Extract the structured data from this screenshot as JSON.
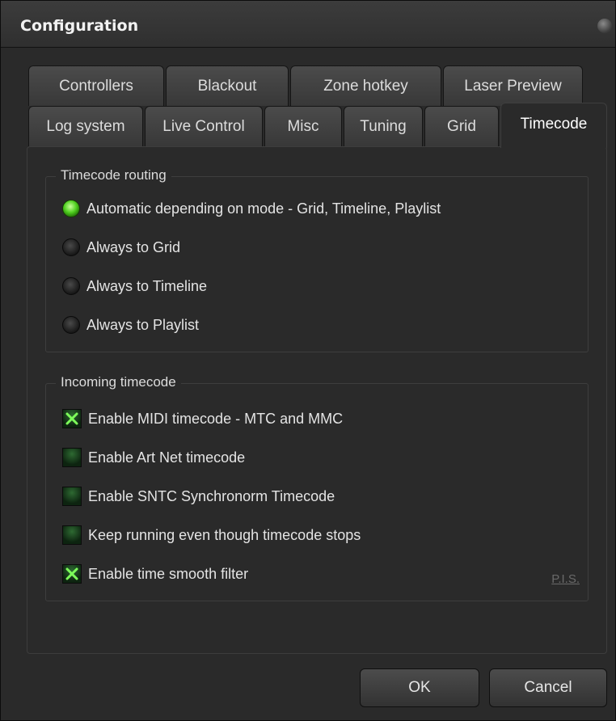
{
  "window": {
    "title": "Configuration"
  },
  "tabs_row1": [
    {
      "label": "Controllers"
    },
    {
      "label": "Blackout"
    },
    {
      "label": "Zone hotkey"
    },
    {
      "label": "Laser Preview"
    }
  ],
  "tabs_row2": [
    {
      "label": "Log system"
    },
    {
      "label": "Live Control"
    },
    {
      "label": "Misc"
    },
    {
      "label": "Tuning"
    },
    {
      "label": "Grid"
    },
    {
      "label": "Timecode",
      "active": true
    }
  ],
  "routing": {
    "legend": "Timecode routing",
    "selected_index": 0,
    "options": [
      {
        "label": "Automatic depending on mode - Grid, Timeline, Playlist"
      },
      {
        "label": "Always to Grid"
      },
      {
        "label": "Always to Timeline"
      },
      {
        "label": "Always to Playlist"
      }
    ]
  },
  "incoming": {
    "legend": "Incoming timecode",
    "options": [
      {
        "label": "Enable MIDI timecode - MTC and MMC",
        "checked": true
      },
      {
        "label": "Enable Art Net timecode",
        "checked": false
      },
      {
        "label": "Enable SNTC Synchronorm Timecode",
        "checked": false
      },
      {
        "label": "Keep running even though timecode stops",
        "checked": false
      },
      {
        "label": "Enable time smooth filter",
        "checked": true
      }
    ],
    "link_label": "P.I.S."
  },
  "buttons": {
    "ok": "OK",
    "cancel": "Cancel"
  },
  "colors": {
    "radio_on": "#4fcf1f",
    "check_mark": "#7dff5a",
    "background": "#2a2a2a"
  }
}
